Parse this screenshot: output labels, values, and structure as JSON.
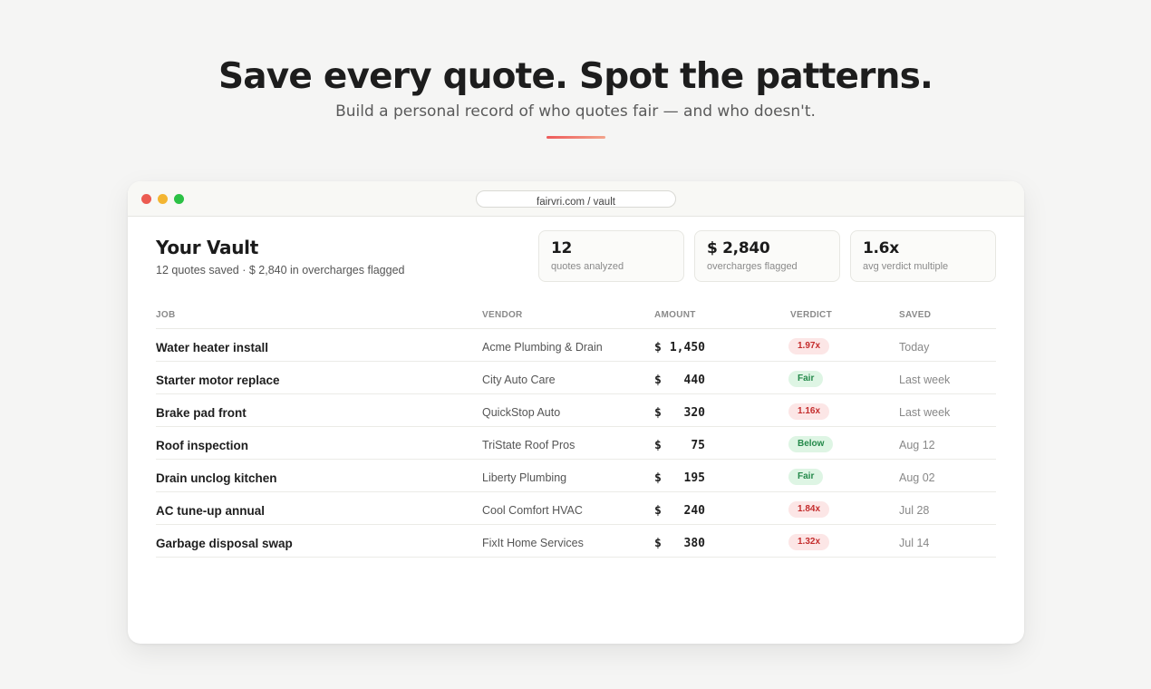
{
  "hero": {
    "title": "Save every quote. Spot the patterns.",
    "subtitle": "Build a personal record of who quotes fair — and who doesn't."
  },
  "browser": {
    "url": "fairvri.com / vault"
  },
  "vault": {
    "title": "Your Vault",
    "subtitle": "12 quotes saved · $ 2,840 in overcharges flagged"
  },
  "stats": [
    {
      "value": "12",
      "label": "quotes analyzed"
    },
    {
      "value": "$ 2,840",
      "label": "overcharges flagged"
    },
    {
      "value": "1.6x",
      "label": "avg verdict multiple"
    }
  ],
  "table": {
    "headers": {
      "job": "JOB",
      "vendor": "VENDOR",
      "amount": "AMOUNT",
      "verdict": "VERDICT",
      "saved": "SAVED"
    },
    "rows": [
      {
        "job": "Water heater install",
        "vendor": "Acme Plumbing & Drain",
        "currency": "$",
        "amount": "1,450",
        "verdict": "1.97x",
        "verdict_kind": "over",
        "saved": "Today"
      },
      {
        "job": "Starter motor replace",
        "vendor": "City Auto Care",
        "currency": "$",
        "amount": "440",
        "verdict": "Fair",
        "verdict_kind": "fair",
        "saved": "Last week"
      },
      {
        "job": "Brake pad front",
        "vendor": "QuickStop Auto",
        "currency": "$",
        "amount": "320",
        "verdict": "1.16x",
        "verdict_kind": "over",
        "saved": "Last week"
      },
      {
        "job": "Roof inspection",
        "vendor": "TriState Roof Pros",
        "currency": "$",
        "amount": "75",
        "verdict": "Below",
        "verdict_kind": "fair",
        "saved": "Aug 12"
      },
      {
        "job": "Drain unclog kitchen",
        "vendor": "Liberty Plumbing",
        "currency": "$",
        "amount": "195",
        "verdict": "Fair",
        "verdict_kind": "fair",
        "saved": "Aug 02"
      },
      {
        "job": "AC tune-up annual",
        "vendor": "Cool Comfort HVAC",
        "currency": "$",
        "amount": "240",
        "verdict": "1.84x",
        "verdict_kind": "over",
        "saved": "Jul 28"
      },
      {
        "job": "Garbage disposal swap",
        "vendor": "FixIt Home Services",
        "currency": "$",
        "amount": "380",
        "verdict": "1.32x",
        "verdict_kind": "over",
        "saved": "Jul 14"
      }
    ]
  },
  "colors": {
    "overcharge_badge_bg": "#fce6e6",
    "overcharge_badge_text": "#c42c2c",
    "fair_badge_bg": "#def5e4",
    "fair_badge_text": "#24894a",
    "accent_gradient_start": "#ee5a5a",
    "accent_gradient_end": "#f2a48c"
  }
}
